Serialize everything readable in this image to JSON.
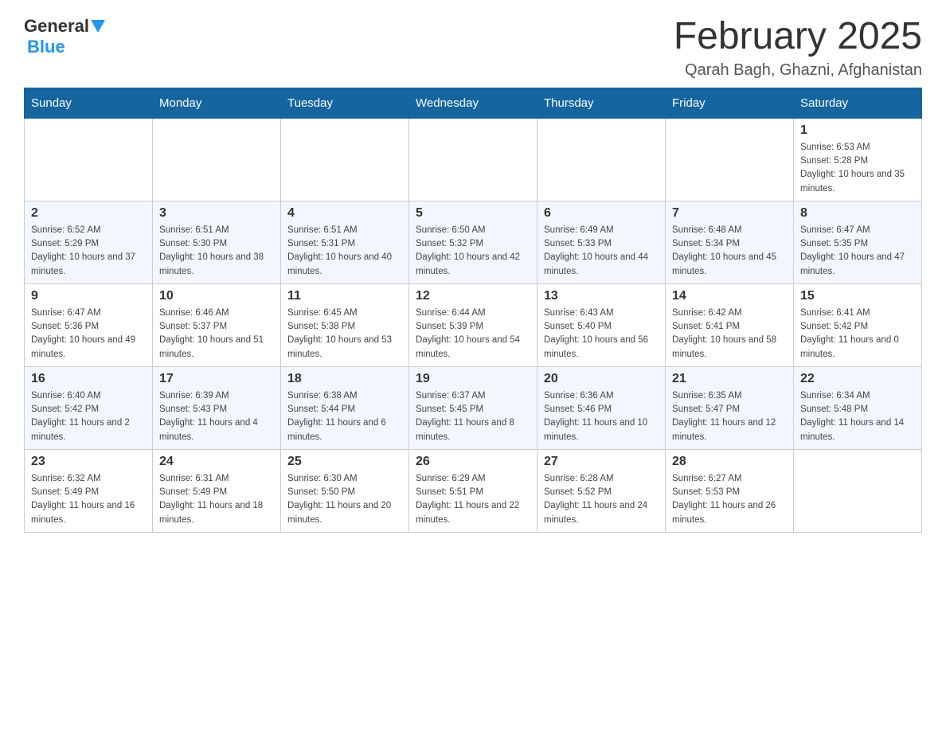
{
  "header": {
    "logo_general": "General",
    "logo_blue": "Blue",
    "month_title": "February 2025",
    "location": "Qarah Bagh, Ghazni, Afghanistan"
  },
  "weekdays": [
    "Sunday",
    "Monday",
    "Tuesday",
    "Wednesday",
    "Thursday",
    "Friday",
    "Saturday"
  ],
  "weeks": [
    [
      {
        "day": "",
        "sunrise": "",
        "sunset": "",
        "daylight": ""
      },
      {
        "day": "",
        "sunrise": "",
        "sunset": "",
        "daylight": ""
      },
      {
        "day": "",
        "sunrise": "",
        "sunset": "",
        "daylight": ""
      },
      {
        "day": "",
        "sunrise": "",
        "sunset": "",
        "daylight": ""
      },
      {
        "day": "",
        "sunrise": "",
        "sunset": "",
        "daylight": ""
      },
      {
        "day": "",
        "sunrise": "",
        "sunset": "",
        "daylight": ""
      },
      {
        "day": "1",
        "sunrise": "Sunrise: 6:53 AM",
        "sunset": "Sunset: 5:28 PM",
        "daylight": "Daylight: 10 hours and 35 minutes."
      }
    ],
    [
      {
        "day": "2",
        "sunrise": "Sunrise: 6:52 AM",
        "sunset": "Sunset: 5:29 PM",
        "daylight": "Daylight: 10 hours and 37 minutes."
      },
      {
        "day": "3",
        "sunrise": "Sunrise: 6:51 AM",
        "sunset": "Sunset: 5:30 PM",
        "daylight": "Daylight: 10 hours and 38 minutes."
      },
      {
        "day": "4",
        "sunrise": "Sunrise: 6:51 AM",
        "sunset": "Sunset: 5:31 PM",
        "daylight": "Daylight: 10 hours and 40 minutes."
      },
      {
        "day": "5",
        "sunrise": "Sunrise: 6:50 AM",
        "sunset": "Sunset: 5:32 PM",
        "daylight": "Daylight: 10 hours and 42 minutes."
      },
      {
        "day": "6",
        "sunrise": "Sunrise: 6:49 AM",
        "sunset": "Sunset: 5:33 PM",
        "daylight": "Daylight: 10 hours and 44 minutes."
      },
      {
        "day": "7",
        "sunrise": "Sunrise: 6:48 AM",
        "sunset": "Sunset: 5:34 PM",
        "daylight": "Daylight: 10 hours and 45 minutes."
      },
      {
        "day": "8",
        "sunrise": "Sunrise: 6:47 AM",
        "sunset": "Sunset: 5:35 PM",
        "daylight": "Daylight: 10 hours and 47 minutes."
      }
    ],
    [
      {
        "day": "9",
        "sunrise": "Sunrise: 6:47 AM",
        "sunset": "Sunset: 5:36 PM",
        "daylight": "Daylight: 10 hours and 49 minutes."
      },
      {
        "day": "10",
        "sunrise": "Sunrise: 6:46 AM",
        "sunset": "Sunset: 5:37 PM",
        "daylight": "Daylight: 10 hours and 51 minutes."
      },
      {
        "day": "11",
        "sunrise": "Sunrise: 6:45 AM",
        "sunset": "Sunset: 5:38 PM",
        "daylight": "Daylight: 10 hours and 53 minutes."
      },
      {
        "day": "12",
        "sunrise": "Sunrise: 6:44 AM",
        "sunset": "Sunset: 5:39 PM",
        "daylight": "Daylight: 10 hours and 54 minutes."
      },
      {
        "day": "13",
        "sunrise": "Sunrise: 6:43 AM",
        "sunset": "Sunset: 5:40 PM",
        "daylight": "Daylight: 10 hours and 56 minutes."
      },
      {
        "day": "14",
        "sunrise": "Sunrise: 6:42 AM",
        "sunset": "Sunset: 5:41 PM",
        "daylight": "Daylight: 10 hours and 58 minutes."
      },
      {
        "day": "15",
        "sunrise": "Sunrise: 6:41 AM",
        "sunset": "Sunset: 5:42 PM",
        "daylight": "Daylight: 11 hours and 0 minutes."
      }
    ],
    [
      {
        "day": "16",
        "sunrise": "Sunrise: 6:40 AM",
        "sunset": "Sunset: 5:42 PM",
        "daylight": "Daylight: 11 hours and 2 minutes."
      },
      {
        "day": "17",
        "sunrise": "Sunrise: 6:39 AM",
        "sunset": "Sunset: 5:43 PM",
        "daylight": "Daylight: 11 hours and 4 minutes."
      },
      {
        "day": "18",
        "sunrise": "Sunrise: 6:38 AM",
        "sunset": "Sunset: 5:44 PM",
        "daylight": "Daylight: 11 hours and 6 minutes."
      },
      {
        "day": "19",
        "sunrise": "Sunrise: 6:37 AM",
        "sunset": "Sunset: 5:45 PM",
        "daylight": "Daylight: 11 hours and 8 minutes."
      },
      {
        "day": "20",
        "sunrise": "Sunrise: 6:36 AM",
        "sunset": "Sunset: 5:46 PM",
        "daylight": "Daylight: 11 hours and 10 minutes."
      },
      {
        "day": "21",
        "sunrise": "Sunrise: 6:35 AM",
        "sunset": "Sunset: 5:47 PM",
        "daylight": "Daylight: 11 hours and 12 minutes."
      },
      {
        "day": "22",
        "sunrise": "Sunrise: 6:34 AM",
        "sunset": "Sunset: 5:48 PM",
        "daylight": "Daylight: 11 hours and 14 minutes."
      }
    ],
    [
      {
        "day": "23",
        "sunrise": "Sunrise: 6:32 AM",
        "sunset": "Sunset: 5:49 PM",
        "daylight": "Daylight: 11 hours and 16 minutes."
      },
      {
        "day": "24",
        "sunrise": "Sunrise: 6:31 AM",
        "sunset": "Sunset: 5:49 PM",
        "daylight": "Daylight: 11 hours and 18 minutes."
      },
      {
        "day": "25",
        "sunrise": "Sunrise: 6:30 AM",
        "sunset": "Sunset: 5:50 PM",
        "daylight": "Daylight: 11 hours and 20 minutes."
      },
      {
        "day": "26",
        "sunrise": "Sunrise: 6:29 AM",
        "sunset": "Sunset: 5:51 PM",
        "daylight": "Daylight: 11 hours and 22 minutes."
      },
      {
        "day": "27",
        "sunrise": "Sunrise: 6:28 AM",
        "sunset": "Sunset: 5:52 PM",
        "daylight": "Daylight: 11 hours and 24 minutes."
      },
      {
        "day": "28",
        "sunrise": "Sunrise: 6:27 AM",
        "sunset": "Sunset: 5:53 PM",
        "daylight": "Daylight: 11 hours and 26 minutes."
      },
      {
        "day": "",
        "sunrise": "",
        "sunset": "",
        "daylight": ""
      }
    ]
  ]
}
